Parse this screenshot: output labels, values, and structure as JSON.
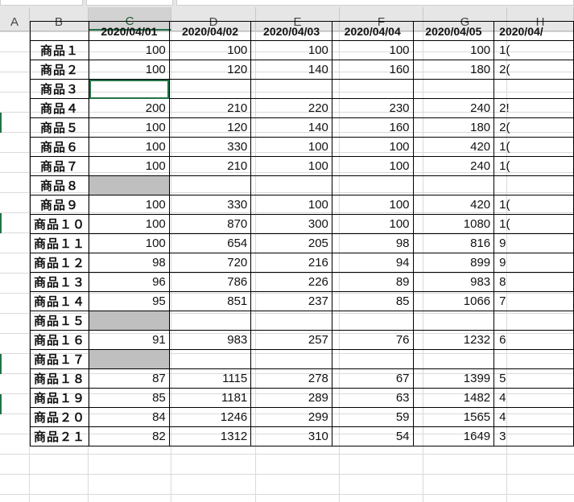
{
  "columns": [
    "A",
    "B",
    "C",
    "D",
    "E",
    "F",
    "G",
    "H"
  ],
  "selected_column": "C",
  "header_row": {
    "corner": "",
    "dates": [
      "2020/04/01",
      "2020/04/02",
      "2020/04/03",
      "2020/04/04",
      "2020/04/05",
      "2020/04/"
    ]
  },
  "rows": [
    {
      "label": "商品１",
      "values": [
        "100",
        "100",
        "100",
        "100",
        "100",
        "1("
      ]
    },
    {
      "label": "商品２",
      "values": [
        "100",
        "120",
        "140",
        "160",
        "180",
        "2("
      ]
    },
    {
      "label": "商品３",
      "values": [
        "",
        "",
        "",
        "",
        "",
        ""
      ],
      "active_cell": true
    },
    {
      "label": "商品４",
      "values": [
        "200",
        "210",
        "220",
        "230",
        "240",
        "2!"
      ]
    },
    {
      "label": "商品５",
      "values": [
        "100",
        "120",
        "140",
        "160",
        "180",
        "2("
      ]
    },
    {
      "label": "商品６",
      "values": [
        "100",
        "330",
        "100",
        "100",
        "420",
        "1("
      ]
    },
    {
      "label": "商品７",
      "values": [
        "100",
        "210",
        "100",
        "100",
        "240",
        "1("
      ]
    },
    {
      "label": "商品８",
      "values": [
        "",
        "",
        "",
        "",
        "",
        ""
      ],
      "gray_first": true
    },
    {
      "label": "商品９",
      "values": [
        "100",
        "330",
        "100",
        "100",
        "420",
        "1("
      ]
    },
    {
      "label": "商品１０",
      "values": [
        "100",
        "870",
        "300",
        "100",
        "1080",
        "1("
      ]
    },
    {
      "label": "商品１１",
      "values": [
        "100",
        "654",
        "205",
        "98",
        "816",
        "9"
      ]
    },
    {
      "label": "商品１２",
      "values": [
        "98",
        "720",
        "216",
        "94",
        "899",
        "9"
      ]
    },
    {
      "label": "商品１３",
      "values": [
        "96",
        "786",
        "226",
        "89",
        "983",
        "8"
      ]
    },
    {
      "label": "商品１４",
      "values": [
        "95",
        "851",
        "237",
        "85",
        "1066",
        "7"
      ]
    },
    {
      "label": "商品１５",
      "values": [
        "",
        "",
        "",
        "",
        "",
        ""
      ],
      "gray_first": true
    },
    {
      "label": "商品１６",
      "values": [
        "91",
        "983",
        "257",
        "76",
        "1232",
        "6"
      ]
    },
    {
      "label": "商品１７",
      "values": [
        "",
        "",
        "",
        "",
        "",
        ""
      ],
      "gray_first": true
    },
    {
      "label": "商品１８",
      "values": [
        "87",
        "1115",
        "278",
        "67",
        "1399",
        "5"
      ]
    },
    {
      "label": "商品１９",
      "values": [
        "85",
        "1181",
        "289",
        "63",
        "1482",
        "4"
      ]
    },
    {
      "label": "商品２０",
      "values": [
        "84",
        "1246",
        "299",
        "59",
        "1565",
        "4"
      ]
    },
    {
      "label": "商品２１",
      "values": [
        "82",
        "1312",
        "310",
        "54",
        "1649",
        "3"
      ]
    }
  ],
  "colors": {
    "accent": "#217346",
    "gray_fill": "#bfbfbf",
    "header_bg": "#e6e6e6"
  }
}
